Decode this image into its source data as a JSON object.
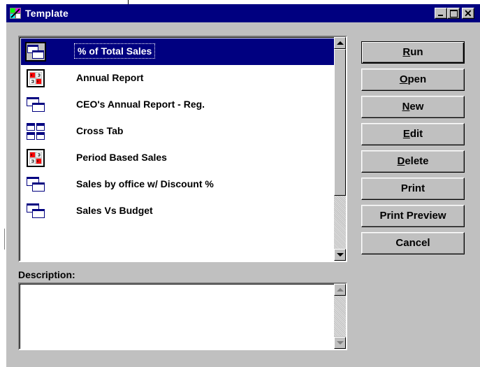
{
  "window": {
    "title": "Template"
  },
  "list": {
    "items": [
      {
        "label": "% of Total Sales",
        "icon": "report-window-icon",
        "selected": true
      },
      {
        "label": "Annual Report",
        "icon": "report-grid-icon",
        "selected": false
      },
      {
        "label": "CEO's Annual Report - Reg.",
        "icon": "report-window-icon",
        "selected": false
      },
      {
        "label": "Cross Tab",
        "icon": "crosstab-icon",
        "selected": false
      },
      {
        "label": "Period Based Sales",
        "icon": "report-grid-icon",
        "selected": false
      },
      {
        "label": "Sales by office w/ Discount %",
        "icon": "report-window-icon",
        "selected": false
      },
      {
        "label": "Sales Vs Budget",
        "icon": "report-window-icon",
        "selected": false
      }
    ]
  },
  "description": {
    "label": "Description:",
    "value": ""
  },
  "buttons": {
    "run": {
      "pre": "",
      "key": "R",
      "post": "un"
    },
    "open": {
      "pre": "",
      "key": "O",
      "post": "pen"
    },
    "new": {
      "pre": "",
      "key": "N",
      "post": "ew"
    },
    "edit": {
      "pre": "",
      "key": "E",
      "post": "dit"
    },
    "delete": {
      "pre": "",
      "key": "D",
      "post": "elete"
    },
    "print": "Print",
    "print_preview": "Print Preview",
    "cancel": "Cancel"
  },
  "colors": {
    "titlebar": "#000080",
    "face": "#c0c0c0",
    "selection": "#000080"
  }
}
